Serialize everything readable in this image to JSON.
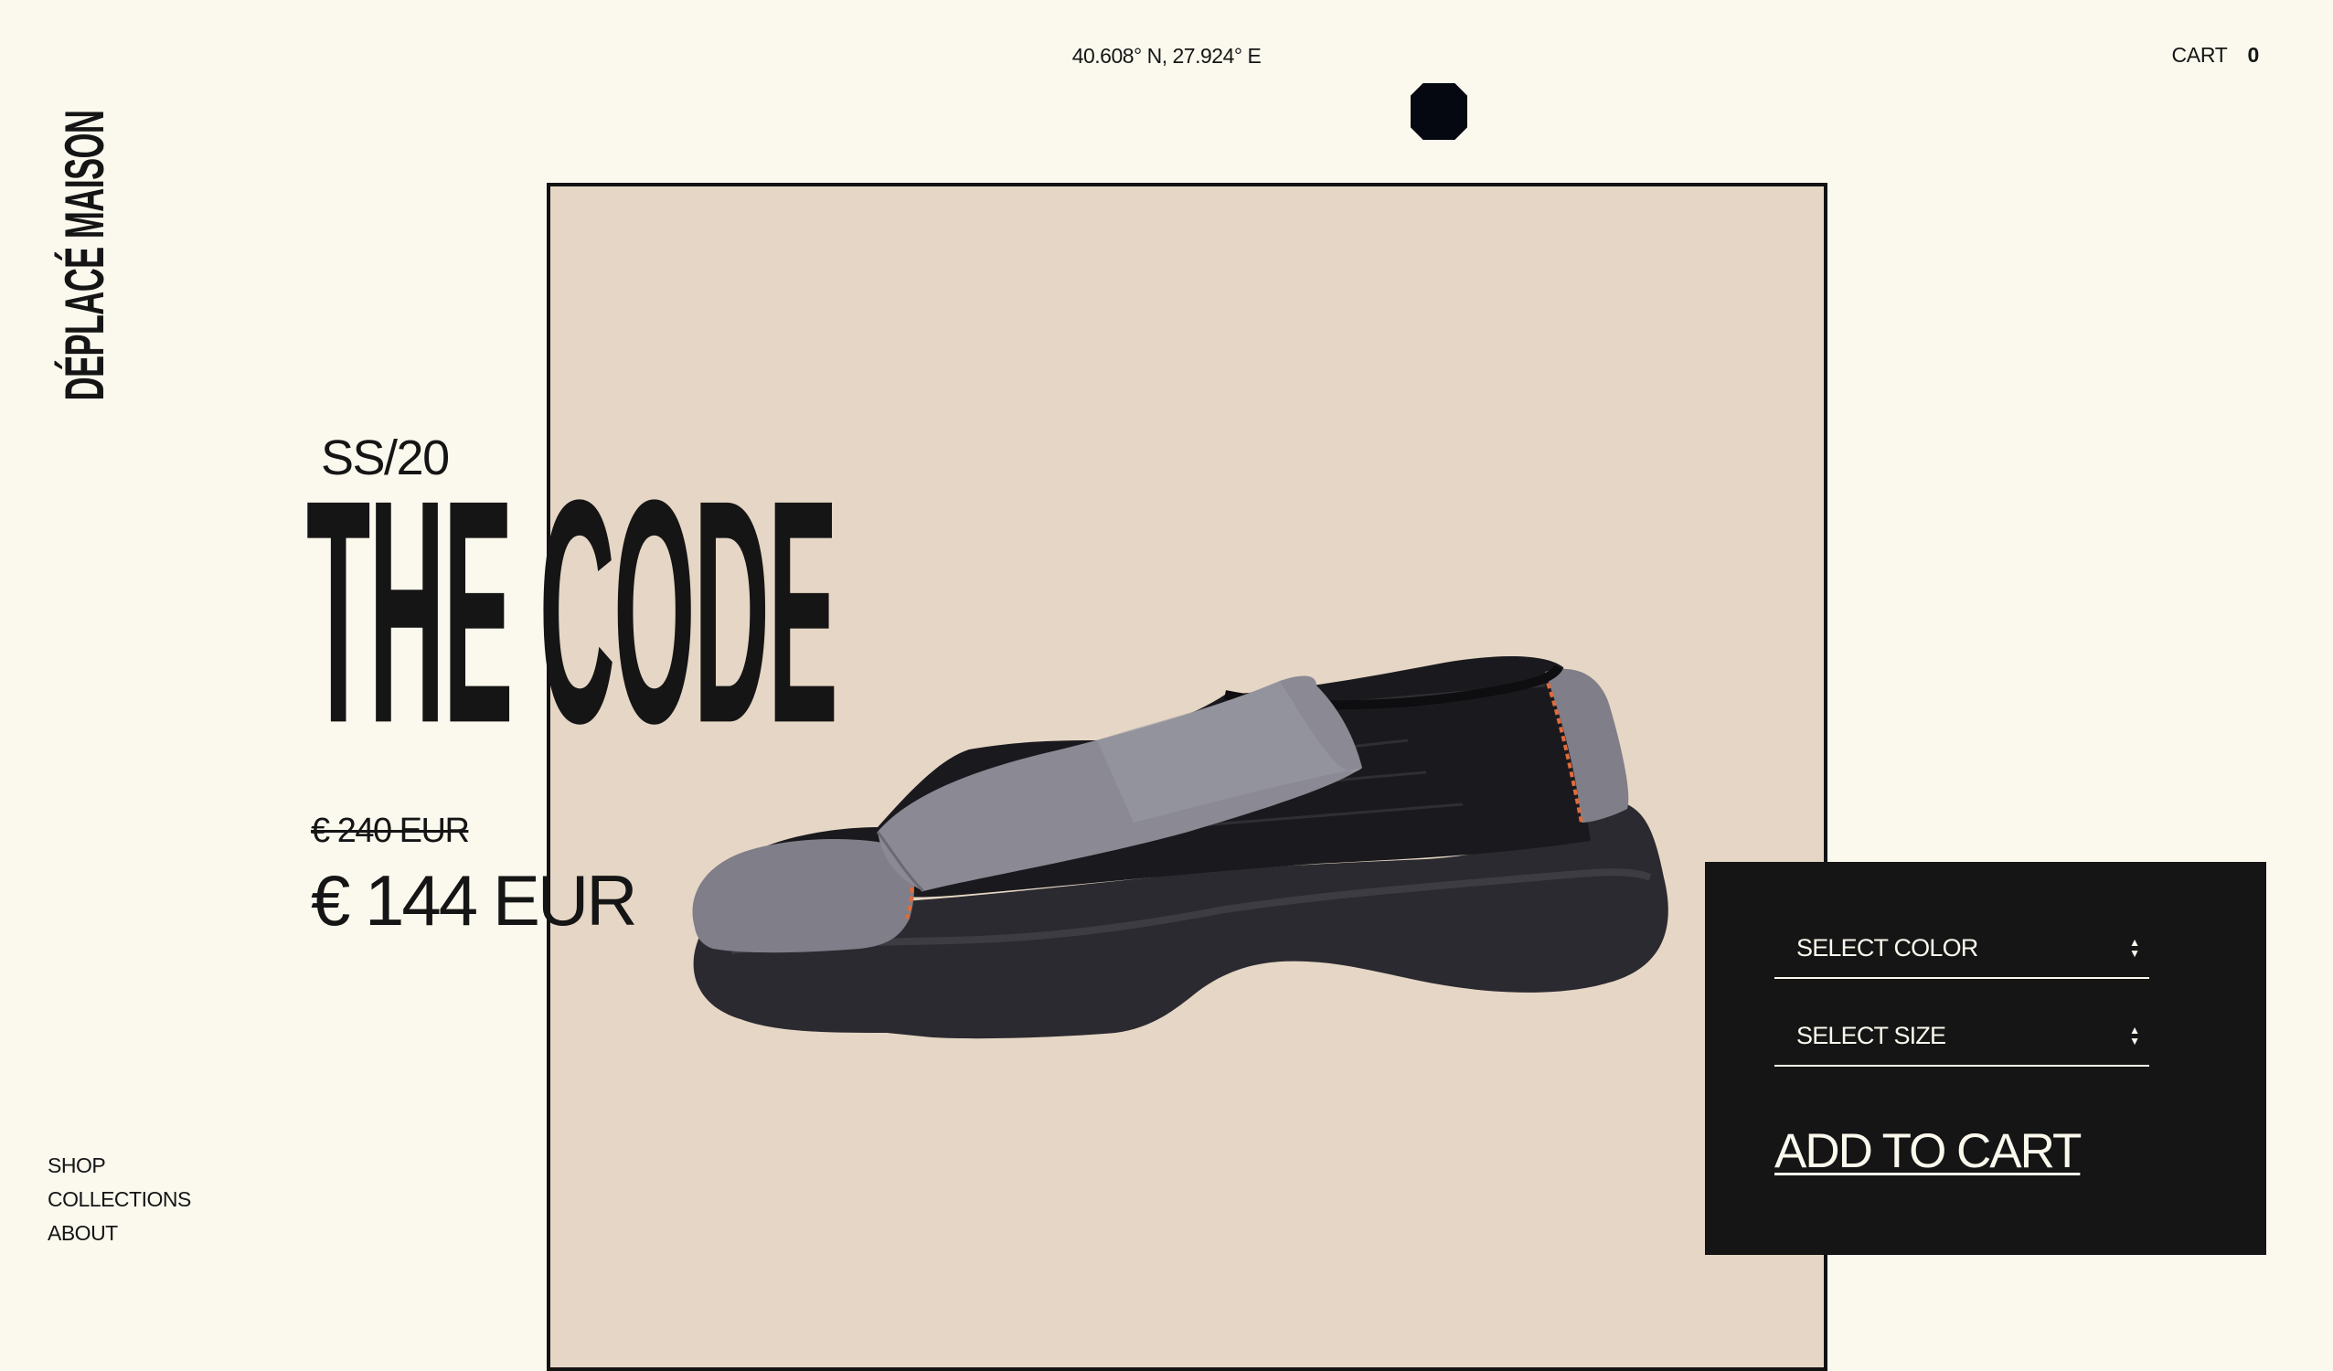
{
  "header": {
    "coordinates": "40.608° N, 27.924° E",
    "cart_label": "CART",
    "cart_count": "0"
  },
  "brand": {
    "name": "DÉPLACÉ MAISON"
  },
  "product": {
    "season": "SS/20",
    "title": "THE CODE",
    "old_price": "€ 240 EUR",
    "price": "€ 144 EUR"
  },
  "purchase_panel": {
    "color_select": "SELECT COLOR",
    "size_select": "SELECT SIZE",
    "add_to_cart": "ADD TO CART"
  },
  "nav": {
    "items": [
      {
        "label": "SHOP"
      },
      {
        "label": "COLLECTIONS"
      },
      {
        "label": "ABOUT"
      }
    ]
  },
  "colors": {
    "background": "#fbf9ee",
    "photo_background": "#e6d6c5",
    "panel": "#151515",
    "text": "#151515",
    "icon_mark": "#050810"
  },
  "icons": {
    "logo_mark": "octagon-icon",
    "select_arrows": "up-down-arrows-icon"
  }
}
